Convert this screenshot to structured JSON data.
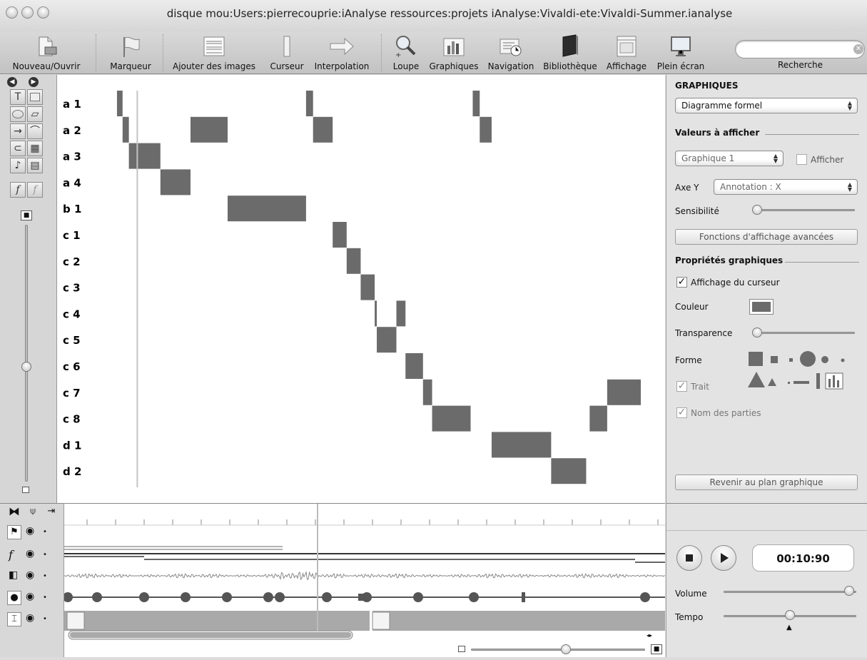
{
  "window": {
    "title": "disque mou:Users:pierrecouprie:iAnalyse ressources:projets iAnalyse:Vivaldi-ete:Vivaldi-Summer.ianalyse"
  },
  "toolbar": {
    "items": [
      {
        "label": "Nouveau/Ouvrir",
        "icon": "new-open-icon"
      },
      {
        "label": "Marqueur",
        "icon": "flag-icon"
      },
      {
        "label": "Ajouter des images",
        "icon": "score-images-icon"
      },
      {
        "label": "Curseur",
        "icon": "cursor-icon"
      },
      {
        "label": "Interpolation",
        "icon": "arrow-right-icon"
      },
      {
        "label": "Loupe",
        "icon": "magnifier-icon"
      },
      {
        "label": "Graphiques",
        "icon": "bar-chart-icon"
      },
      {
        "label": "Navigation",
        "icon": "navigation-icon"
      },
      {
        "label": "Bibliothèque",
        "icon": "book-icon"
      },
      {
        "label": "Affichage",
        "icon": "display-icon"
      },
      {
        "label": "Plein écran",
        "icon": "monitor-icon"
      }
    ],
    "search_label": "Recherche",
    "search_value": ""
  },
  "chart_data": {
    "type": "formal-diagram",
    "rows": [
      "a 1",
      "a 2",
      "a 3",
      "a 4",
      "b 1",
      "c 1",
      "c 2",
      "c 3",
      "c 4",
      "c 5",
      "c 6",
      "c 7",
      "c 8",
      "d 1",
      "d 2"
    ],
    "segments": [
      {
        "row": "a 1",
        "start": 0.0,
        "end": 0.8
      },
      {
        "row": "a 1",
        "start": 27.0,
        "end": 28.0
      },
      {
        "row": "a 1",
        "start": 50.8,
        "end": 51.8
      },
      {
        "row": "a 2",
        "start": 0.8,
        "end": 1.7
      },
      {
        "row": "a 2",
        "start": 10.5,
        "end": 15.8
      },
      {
        "row": "a 2",
        "start": 28.0,
        "end": 30.8
      },
      {
        "row": "a 2",
        "start": 51.8,
        "end": 53.5
      },
      {
        "row": "a 3",
        "start": 1.7,
        "end": 6.2
      },
      {
        "row": "a 4",
        "start": 6.2,
        "end": 10.5
      },
      {
        "row": "b 1",
        "start": 15.8,
        "end": 27.0
      },
      {
        "row": "c 1",
        "start": 30.8,
        "end": 32.8
      },
      {
        "row": "c 2",
        "start": 32.8,
        "end": 34.8
      },
      {
        "row": "c 3",
        "start": 34.8,
        "end": 36.8
      },
      {
        "row": "c 4",
        "start": 36.8,
        "end": 37.1
      },
      {
        "row": "c 4",
        "start": 39.9,
        "end": 41.2
      },
      {
        "row": "c 5",
        "start": 37.1,
        "end": 39.9
      },
      {
        "row": "c 6",
        "start": 41.2,
        "end": 43.7
      },
      {
        "row": "c 7",
        "start": 43.7,
        "end": 45.0
      },
      {
        "row": "c 7",
        "start": 70.0,
        "end": 74.8
      },
      {
        "row": "c 8",
        "start": 45.0,
        "end": 50.5
      },
      {
        "row": "c 8",
        "start": 67.5,
        "end": 70.0
      },
      {
        "row": "d 1",
        "start": 53.5,
        "end": 62.0
      },
      {
        "row": "d 2",
        "start": 62.0,
        "end": 67.0
      }
    ],
    "cursor_x": 2.9,
    "xlim": [
      -0.4,
      74.8
    ],
    "color": "#6b6b6b"
  },
  "panel": {
    "title": "GRAPHIQUES",
    "type_select": "Diagramme formel",
    "values_header": "Valeurs à afficher",
    "graph_select": "Graphique 1",
    "show_label": "Afficher",
    "show_checked": false,
    "axis_y_label": "Axe Y",
    "axis_y_select": "Annotation : X",
    "sensitivity_label": "Sensibilité",
    "sensitivity_value": 0.06,
    "advanced_button": "Fonctions d'affichage avancées",
    "props_header": "Propriétés graphiques",
    "cursor_display": "Affichage du curseur",
    "cursor_display_checked": true,
    "color_label": "Couleur",
    "color_value": "#6b6b6b",
    "transparency_label": "Transparence",
    "transparency_value": 0.04,
    "shape_label": "Forme",
    "trait_label": "Trait",
    "parts_label": "Nom des parties",
    "back_button": "Revenir au plan graphique"
  },
  "player": {
    "time": "00:10:90",
    "volume_label": "Volume",
    "volume_value": 0.98,
    "tempo_label": "Tempo",
    "tempo_value": 0.5
  },
  "timeline": {
    "playhead": 0.42,
    "zoom_value": 0.6
  }
}
